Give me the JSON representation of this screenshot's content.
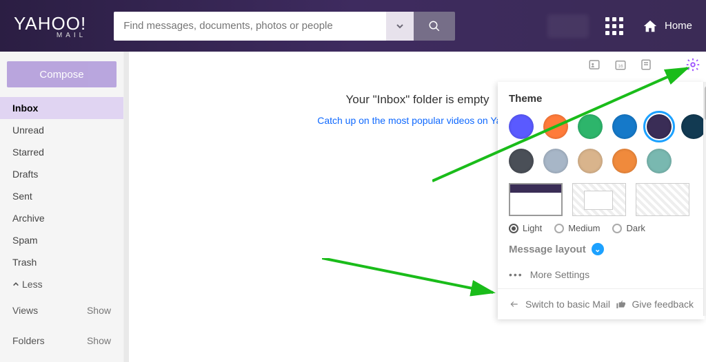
{
  "header": {
    "logo_main": "YAHOO!",
    "logo_sub": "MAIL",
    "search_placeholder": "Find messages, documents, photos or people",
    "home_label": "Home"
  },
  "sidebar": {
    "compose_label": "Compose",
    "folders": [
      "Inbox",
      "Unread",
      "Starred",
      "Drafts",
      "Sent",
      "Archive",
      "Spam",
      "Trash"
    ],
    "active_folder": "Inbox",
    "less_label": "Less",
    "sections": [
      {
        "label": "Views",
        "action": "Show"
      },
      {
        "label": "Folders",
        "action": "Show"
      }
    ]
  },
  "main": {
    "empty_title": "Your \"Inbox\" folder is empty",
    "empty_link": "Catch up on the most popular videos on Yahoo"
  },
  "panel": {
    "heading": "Theme",
    "swatch_colors_row1": [
      "#5a5aff",
      "#ff7b3a",
      "#2db56b",
      "#1579c9",
      "#3a2d56",
      "#123a52"
    ],
    "swatch_colors_row2": [
      "#4a4f57",
      "#a7b6c7",
      "#d9b48c",
      "#f08a3c",
      "#79b8b0"
    ],
    "selected_swatch_index": 4,
    "modes": [
      "Light",
      "Medium",
      "Dark"
    ],
    "selected_mode": "Light",
    "message_layout_label": "Message layout",
    "more_settings_label": "More Settings",
    "basic_label": "Switch to basic Mail",
    "feedback_label": "Give feedback"
  }
}
